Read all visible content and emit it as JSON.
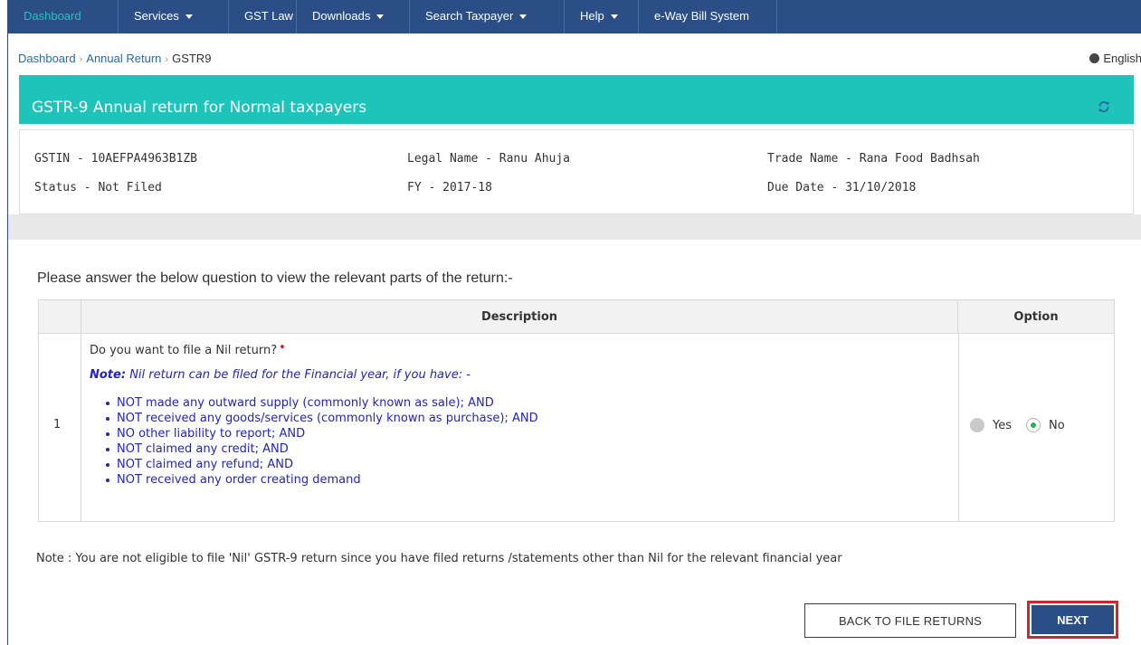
{
  "nav": {
    "items": [
      {
        "label": "Dashboard",
        "dropdown": false,
        "active": true
      },
      {
        "label": "Services",
        "dropdown": true,
        "active": false
      },
      {
        "label": "GST Law",
        "dropdown": false,
        "active": false
      },
      {
        "label": "Downloads",
        "dropdown": true,
        "active": false
      },
      {
        "label": "Search Taxpayer",
        "dropdown": true,
        "active": false
      },
      {
        "label": "Help",
        "dropdown": true,
        "active": false
      },
      {
        "label": "e-Way Bill System",
        "dropdown": false,
        "active": false
      }
    ]
  },
  "breadcrumb": {
    "items": [
      "Dashboard",
      "Annual Return",
      "GSTR9"
    ]
  },
  "language": {
    "label": "English",
    "icon": "globe-icon"
  },
  "title_bar": {
    "title": "GSTR-9 Annual return for Normal taxpayers",
    "refresh_icon": "refresh-icon"
  },
  "info": {
    "gstin": "GSTIN - 10AEFPA4963B1ZB",
    "legal_name": "Legal Name - Ranu Ahuja",
    "trade_name": "Trade Name - Rana Food Badhsah",
    "status": "Status - Not Filed",
    "fy": "FY - 2017-18",
    "due_date": "Due Date - 31/10/2018"
  },
  "question": {
    "intro": "Please answer the below question to view the relevant parts of the return:-"
  },
  "table": {
    "headers": {
      "description": "Description",
      "option": "Option"
    },
    "row": {
      "number": "1",
      "question": "Do you want to file a Nil return?",
      "required_marker": "•",
      "note_label": "Note:",
      "note_text": "Nil return can be filed for the Financial year, if you have: -",
      "bullets": [
        "NOT made any outward supply (commonly known as sale); AND",
        "NOT received any goods/services (commonly known as purchase); AND",
        "NO other liability to report; AND",
        "NOT claimed any credit; AND",
        "NOT claimed any refund; AND",
        "NOT received any order creating demand"
      ],
      "options": [
        {
          "label": "Yes",
          "selected": false,
          "disabled": true
        },
        {
          "label": "No",
          "selected": true,
          "disabled": false
        }
      ]
    }
  },
  "bottom_note": "Note : You are not eligible to file 'Nil' GSTR-9 return since you have filed returns /statements other than Nil for the relevant financial year",
  "buttons": {
    "back": "BACK TO FILE RETURNS",
    "next": "NEXT"
  },
  "colors": {
    "nav_bg": "#2c4e86",
    "teal": "#1ec4ba",
    "note_blue": "#2222cc",
    "highlight_red": "#d3232d",
    "radio_green": "#2bb24c"
  }
}
